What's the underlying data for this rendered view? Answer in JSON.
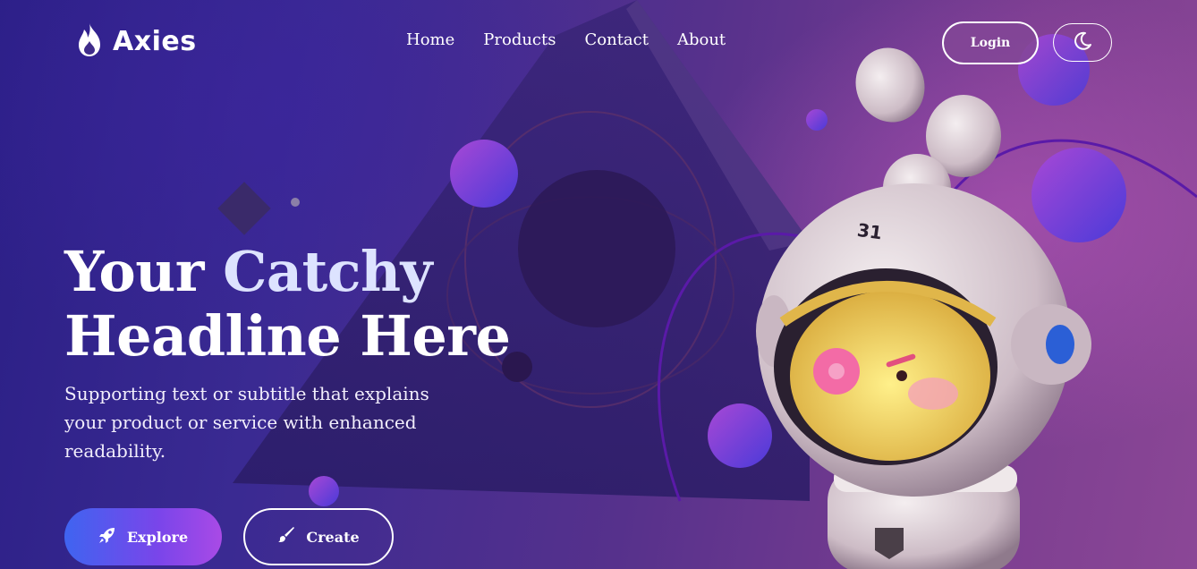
{
  "brand": {
    "name": "Axies",
    "icon": "flame-icon"
  },
  "nav": {
    "items": [
      "Home",
      "Products",
      "Contact",
      "About"
    ]
  },
  "header": {
    "login_label": "Login",
    "theme_icon": "moon-icon"
  },
  "hero": {
    "headline_part1": "Your ",
    "headline_part2": "Catchy",
    "headline_part3": "Headline Here",
    "subtitle": "Supporting text or subtitle that explains your product or service with enhanced readability.",
    "explore_label": "Explore",
    "explore_icon": "rocket-icon",
    "create_label": "Create",
    "create_icon": "brush-icon",
    "mascot_badge": "31"
  },
  "colors": {
    "accent_gradient_start": "#3f64f0",
    "accent_gradient_end": "#a94ae6",
    "headline_accent": "#dde3ff"
  }
}
